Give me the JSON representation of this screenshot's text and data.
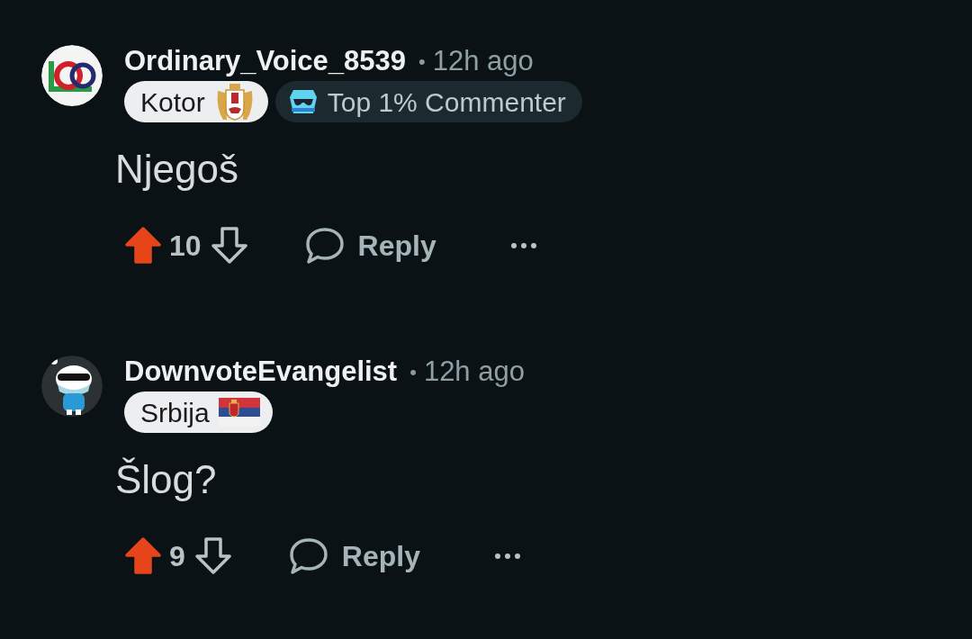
{
  "comments": [
    {
      "author": "Ordinary_Voice_8539",
      "kind": "logo",
      "separator": "•",
      "time": "12h ago",
      "flairs": [
        {
          "kind": "arms",
          "text": "Kotor"
        },
        {
          "kind": "achievement",
          "text": "Top 1% Commenter"
        }
      ],
      "body": "Njegoš",
      "upvoted": true,
      "downvoted": false,
      "score": "10",
      "reply": "Reply"
    },
    {
      "author": "DownvoteEvangelist",
      "kind": "mascot",
      "separator": "•",
      "time": "12h ago",
      "flairs": [
        {
          "kind": "flag",
          "text": "Srbija"
        }
      ],
      "body": "Šlog?",
      "upvoted": true,
      "downvoted": false,
      "score": "9",
      "reply": "Reply"
    }
  ]
}
